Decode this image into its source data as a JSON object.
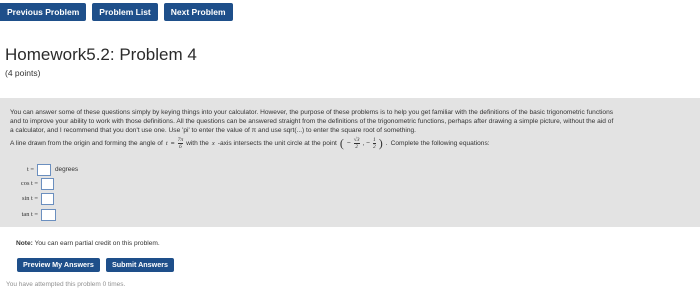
{
  "nav": {
    "previous": "Previous Problem",
    "list": "Problem List",
    "next": "Next Problem"
  },
  "header": {
    "title": "Homework5.2: Problem 4",
    "points": "(4 points)"
  },
  "problem": {
    "line1": "You can answer some of these questions simply by keying things into your calculator. However, the purpose of these problems is to help you get familiar with the definitions of the basic trigonometric functions",
    "line2": "and to improve your ability to work with those definitions. All the questions can be answered straight from the definitions of the trigonometric functions, perhaps after drawing a simple picture, without the aid of",
    "line3": "a calculator, and I recommend that you don't use one. Use 'pi' to enter the value of π and use sqrt(...) to enter the square root of something.",
    "line4_prefix": "A line drawn from the origin and forming the angle of",
    "t_var": "t",
    "angle_num": "7π",
    "angle_den": "6",
    "line4_mid": "with the",
    "x_var": "x",
    "line4_mid2": "-axis intersects the unit circle at the point",
    "point_x_num": "√3",
    "point_x_den": "2",
    "point_y_num": "1",
    "point_y_den": "2",
    "line4_suffix": "Complete the following equations:",
    "equations": [
      {
        "label": "t =",
        "unit": "degrees"
      },
      {
        "label": "cos t =",
        "unit": ""
      },
      {
        "label": "sin t =",
        "unit": ""
      },
      {
        "label": "tan t =",
        "unit": ""
      }
    ]
  },
  "note": {
    "label": "Note:",
    "text": "You can earn partial credit on this problem."
  },
  "actions": {
    "preview": "Preview My Answers",
    "submit": "Submit Answers"
  },
  "attempts_text": "You have attempted this problem 0 times."
}
